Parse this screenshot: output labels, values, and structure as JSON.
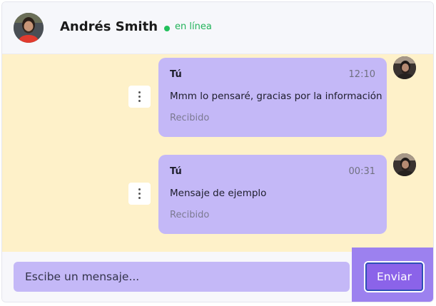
{
  "header": {
    "contact_name": "Andrés Smith",
    "status": "en línea",
    "status_color": "#22c05c"
  },
  "messages": [
    {
      "sender": "Tú",
      "time": "12:10",
      "text": "Mmm lo pensaré, gracias por la información",
      "status": "Recibido"
    },
    {
      "sender": "Tú",
      "time": "00:31",
      "text": "Mensaje de ejemplo",
      "status": "Recibido"
    }
  ],
  "composer": {
    "placeholder": "Escibe un mensaje...",
    "send_label": "Enviar"
  },
  "colors": {
    "message_area_bg": "#fef1c9",
    "bubble_bg": "#c4b8f7",
    "send_button_bg": "#8b63e9"
  },
  "icons": {
    "message_menu": "vertical-ellipsis-icon"
  }
}
